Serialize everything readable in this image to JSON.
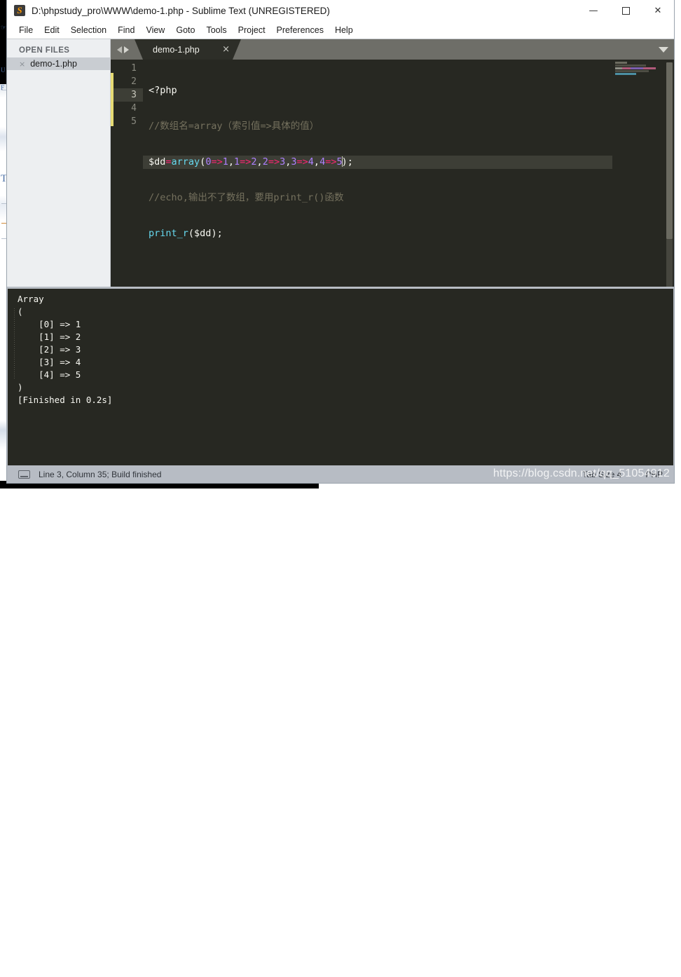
{
  "window": {
    "title": "D:\\phpstudy_pro\\WWW\\demo-1.php - Sublime Text (UNREGISTERED)",
    "app_icon": "sublime-text-icon",
    "controls": {
      "minimize": "—",
      "maximize": "☐",
      "close": "✕"
    }
  },
  "menubar": {
    "items": [
      {
        "label": "File"
      },
      {
        "label": "Edit"
      },
      {
        "label": "Selection"
      },
      {
        "label": "Find"
      },
      {
        "label": "View"
      },
      {
        "label": "Goto"
      },
      {
        "label": "Tools"
      },
      {
        "label": "Project"
      },
      {
        "label": "Preferences"
      },
      {
        "label": "Help"
      }
    ]
  },
  "sidebar": {
    "header": "OPEN FILES",
    "files": [
      {
        "name": "demo-1.php",
        "close_glyph": "×"
      }
    ]
  },
  "tabbar": {
    "nav_prev": "prev-tab-arrow",
    "nav_next": "next-tab-arrow",
    "tabs": [
      {
        "label": "demo-1.php",
        "close_glyph": "×",
        "active": true
      }
    ],
    "dropdown": "tab-list-dropdown"
  },
  "editor": {
    "language": "PHP",
    "line_numbers": [
      "1",
      "2",
      "3",
      "4",
      "5"
    ],
    "active_line": 3,
    "lines": [
      {
        "n": 1,
        "tokens": [
          {
            "t": "tag",
            "v": "<?php"
          }
        ]
      },
      {
        "n": 2,
        "tokens": [
          {
            "t": "comment",
            "v": "//数组名=array（索引值=>具体的值）"
          }
        ]
      },
      {
        "n": 3,
        "tokens": [
          {
            "t": "var",
            "v": "$dd"
          },
          {
            "t": "op",
            "v": "="
          },
          {
            "t": "fn",
            "v": "array"
          },
          {
            "t": "punc",
            "v": "("
          },
          {
            "t": "num",
            "v": "0"
          },
          {
            "t": "op",
            "v": "=>"
          },
          {
            "t": "num",
            "v": "1"
          },
          {
            "t": "punc",
            "v": ","
          },
          {
            "t": "num",
            "v": "1"
          },
          {
            "t": "op",
            "v": "=>"
          },
          {
            "t": "num",
            "v": "2"
          },
          {
            "t": "punc",
            "v": ","
          },
          {
            "t": "num",
            "v": "2"
          },
          {
            "t": "op",
            "v": "=>"
          },
          {
            "t": "num",
            "v": "3"
          },
          {
            "t": "punc",
            "v": ","
          },
          {
            "t": "num",
            "v": "3"
          },
          {
            "t": "op",
            "v": "=>"
          },
          {
            "t": "num",
            "v": "4"
          },
          {
            "t": "punc",
            "v": ","
          },
          {
            "t": "num",
            "v": "4"
          },
          {
            "t": "op",
            "v": "=>"
          },
          {
            "t": "num",
            "v": "5"
          },
          {
            "t": "caret",
            "v": ""
          },
          {
            "t": "punc",
            "v": ");"
          }
        ]
      },
      {
        "n": 4,
        "tokens": [
          {
            "t": "comment",
            "v": "//echo,输出不了数组，要用print_r()函数"
          }
        ]
      },
      {
        "n": 5,
        "tokens": [
          {
            "t": "fn",
            "v": "print_r"
          },
          {
            "t": "punc",
            "v": "("
          },
          {
            "t": "var",
            "v": "$dd"
          },
          {
            "t": "punc",
            "v": ");"
          }
        ]
      }
    ],
    "modified_indicator_color": "#e6db74",
    "background_color": "#272822"
  },
  "console": {
    "output": "Array\n(\n    [0] => 1\n    [1] => 2\n    [2] => 3\n    [3] => 4\n    [4] => 5\n)\n[Finished in 0.2s]",
    "build_time": "0.2s"
  },
  "statusbar": {
    "icon": "console-panel-icon",
    "left_text": "Line 3, Column 35; Build finished",
    "line": "3",
    "column": "35",
    "build_status": "Build finished",
    "tab_size": "Tab Size 4",
    "syntax": "PHP"
  },
  "watermark": {
    "text": "https://blog.csdn.net/qq_51054912"
  }
}
